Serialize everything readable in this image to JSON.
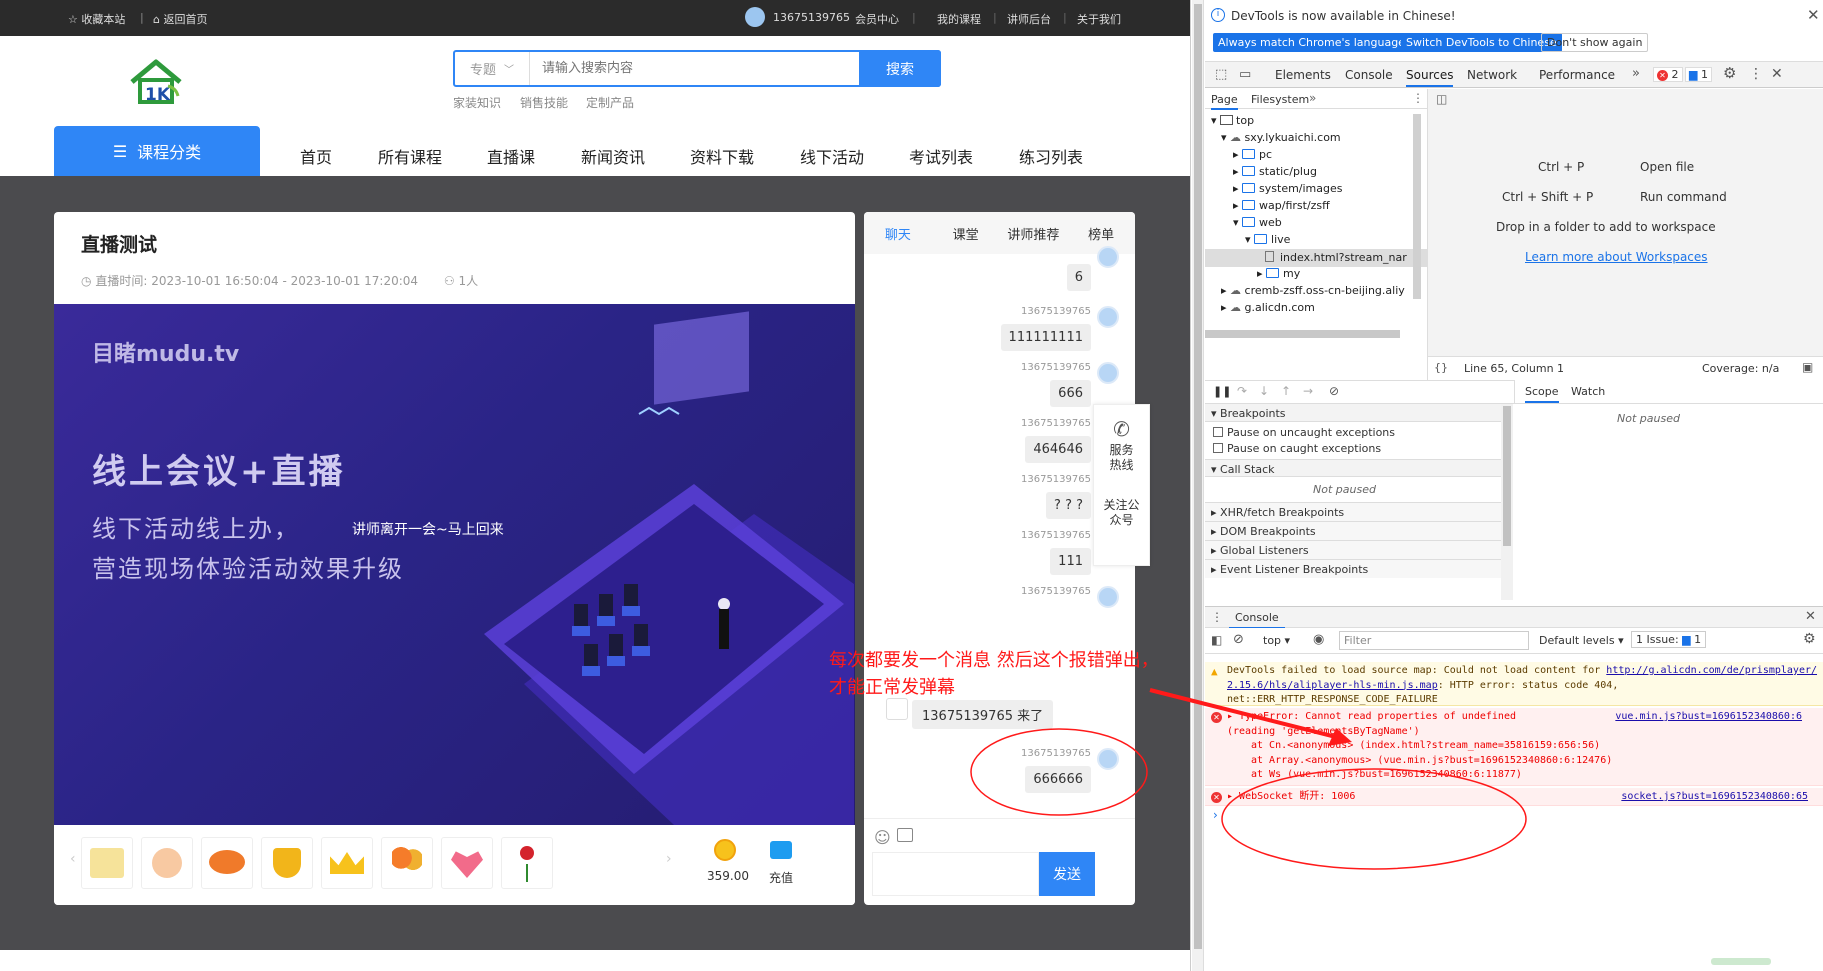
{
  "site": {
    "topbar": {
      "bookmark": "收藏本站",
      "home": "返回首页",
      "user": "13675139765",
      "links": [
        "会员中心",
        "我的课程",
        "讲师后台",
        "关于我们"
      ]
    },
    "search": {
      "category": "专题",
      "placeholder": "请输入搜索内容",
      "button": "搜索",
      "hot": [
        "家装知识",
        "销售技能",
        "定制产品"
      ]
    },
    "category_button": "课程分类",
    "nav": [
      "首页",
      "所有课程",
      "直播课",
      "新闻资讯",
      "资料下载",
      "线下活动",
      "考试列表",
      "练习列表"
    ],
    "live": {
      "title": "直播测试",
      "time_label": "直播时间:",
      "time_value": "2023-10-01 16:50:04 - 2023-10-01 17:20:04",
      "viewers": "1人",
      "video": {
        "brand": "目睹mudu.tv",
        "headline": "线上会议+直播",
        "line1": "线下活动线上办，",
        "line2": "营造现场体验活动效果升级",
        "overlay": "讲师离开一会~马上回来"
      }
    },
    "gifts": {
      "coin": "359.00",
      "recharge": "充值"
    },
    "chat": {
      "tabs": [
        "聊天",
        "课堂",
        "讲师推荐",
        "榜单"
      ],
      "messages": [
        {
          "user": "",
          "text": "6"
        },
        {
          "user": "13675139765",
          "text": "111111111"
        },
        {
          "user": "13675139765",
          "text": "666"
        },
        {
          "user": "13675139765",
          "text": "464646"
        },
        {
          "user": "13675139765",
          "text": "? ? ?"
        },
        {
          "user": "13675139765",
          "text": "111"
        },
        {
          "user": "13675139765",
          "text": ""
        },
        {
          "user": "13675139765",
          "text": "666666"
        }
      ],
      "system_msg": "13675139765 来了",
      "send": "发送"
    },
    "side": {
      "hotline": "服务热线",
      "follow": "关注公众号"
    },
    "annotation": {
      "line1": "每次都要发一个消息 然后这个报错弹出，",
      "line2": "才能正常发弹幕"
    }
  },
  "devtools": {
    "banner": "DevTools is now available in Chinese!",
    "banner_buttons": [
      "Always match Chrome's language",
      "Switch DevTools to Chinese",
      "Don't show again"
    ],
    "tabs": [
      "Elements",
      "Console",
      "Sources",
      "Network",
      "Performance"
    ],
    "error_count": "2",
    "message_count": "1",
    "subtabs": [
      "Page",
      "Filesystem"
    ],
    "tree": {
      "top": "top",
      "domain": "sxy.lykuaichi.com",
      "folders": [
        "pc",
        "static/plug",
        "system/images",
        "wap/first/zsff",
        "web",
        "live"
      ],
      "file": "index.html?stream_nar",
      "my": "my",
      "cdn1": "cremb-zsff.oss-cn-beijing.aliy",
      "cdn2": "g.alicdn.com"
    },
    "shortcuts": [
      {
        "key": "Ctrl + P",
        "action": "Open file"
      },
      {
        "key": "Ctrl + Shift + P",
        "action": "Run command"
      }
    ],
    "drop_text": "Drop in a folder to add to workspace",
    "learn_more": "Learn more about Workspaces",
    "status": {
      "position": "Line 65, Column 1",
      "coverage": "Coverage: n/a"
    },
    "debugger": {
      "breakpoints": "Breakpoints",
      "pause_uncaught": "Pause on uncaught exceptions",
      "pause_caught": "Pause on caught exceptions",
      "call_stack": "Call Stack",
      "not_paused": "Not paused",
      "sections": [
        "XHR/fetch Breakpoints",
        "DOM Breakpoints",
        "Global Listeners",
        "Event Listener Breakpoints"
      ],
      "scope": "Scope",
      "watch": "Watch"
    },
    "console": {
      "title": "Console",
      "context": "top",
      "filter_placeholder": "Filter",
      "levels": "Default levels",
      "issues": "1 Issue:",
      "issues_count": "1",
      "warning": {
        "text1": "DevTools failed to load source map: Could not load content for ",
        "link": "http://g.alicdn.com/de/prismplayer/2.15.6/hls/aliplayer-hls-min.js.map",
        "text2": ": HTTP error: status code 404, net::ERR_HTTP_RESPONSE_CODE_FAILURE"
      },
      "error1": {
        "head": "TypeError: Cannot read properties of undefined",
        "head2": "(reading 'getElementsByTagName')",
        "src": "vue.min.js?bust=1696152340860:6",
        "at1": "at Cn.<anonymous> (index.html?stream_name=35816159:656:56)",
        "at2": "at Array.<anonymous> (vue.min.js?bust=1696152340860:6:12476)",
        "at3": "at Ws (vue.min.js?bust=1696152340860:6:11877)"
      },
      "error2": {
        "head": "WebSocket 断开: 1006",
        "src": "socket.js?bust=1696152340860:65"
      }
    }
  }
}
